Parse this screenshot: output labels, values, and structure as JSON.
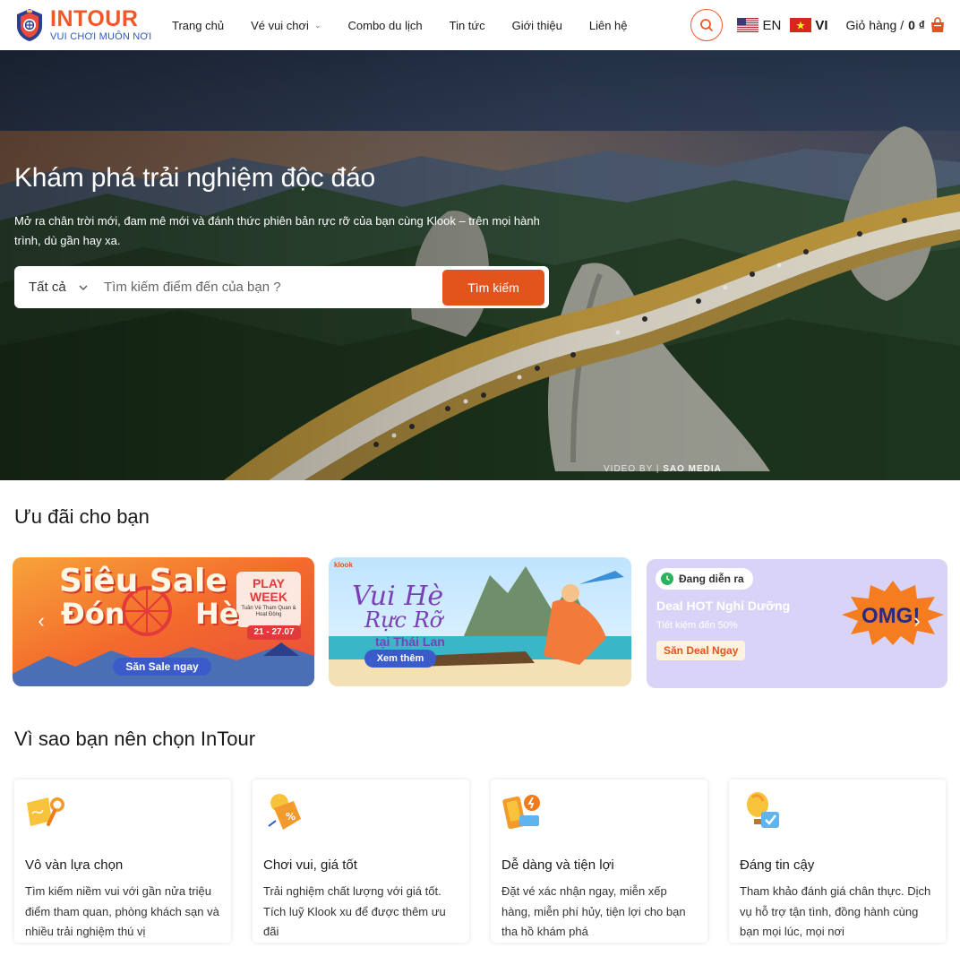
{
  "brand": {
    "name": "INTOUR",
    "tagline": "VUI CHƠI MUÔN NƠI",
    "accent": "#f0582a",
    "secondary": "#2b59c3"
  },
  "nav": {
    "items": [
      {
        "label": "Trang chủ"
      },
      {
        "label": "Vé vui chơi",
        "has_dropdown": true
      },
      {
        "label": "Combo du lịch"
      },
      {
        "label": "Tin tức"
      },
      {
        "label": "Giới thiệu"
      },
      {
        "label": "Liên hệ"
      }
    ],
    "search_icon": "search-icon",
    "lang_en": "EN",
    "lang_vi": "VI",
    "cart_label": "Giỏ hàng /",
    "cart_total": "0 ₫"
  },
  "hero": {
    "title": "Khám phá trải nghiệm độc đáo",
    "description": "Mở ra chân trời mới, đam mê mới và đánh thức phiên bản rực rỡ của bạn cùng Klook – trên mọi hành trình, dù gần hay xa.",
    "filter_label": "Tất cả",
    "search_placeholder": "Tìm kiếm điểm đến của bạn ?",
    "search_button": "Tìm kiếm",
    "button_color": "#e2541b",
    "watermark_prefix": "VIDEO BY",
    "watermark_brand": "SAO MEDIA"
  },
  "offers": {
    "title": "Ưu đãi cho bạn",
    "banner1": {
      "line1": "Siêu Sale",
      "line2": "Đón",
      "line3": "Hè",
      "badge_title": "PLAY WEEK",
      "badge_sub": "Tuần Vé Tham Quan & Hoạt Động",
      "badge_date": "21 - 27.07",
      "cta": "Săn Sale ngay"
    },
    "banner2": {
      "brand": "klook",
      "line1": "Vui Hè",
      "line2": "Rực Rỡ",
      "line3": "tại Thái Lan",
      "cta": "Xem thêm"
    },
    "banner3": {
      "status": "Đang diễn ra",
      "title": "Deal HOT Nghỉ Dưỡng",
      "subtitle": "Tiết kiệm đến 50%",
      "cta": "Săn Deal Ngay",
      "burst": "OMG!"
    }
  },
  "why": {
    "title": "Vì sao bạn nên chọn InTour",
    "cards": [
      {
        "title": "Vô vàn lựa chọn",
        "desc": "Tìm kiếm niềm vui với gần nửa triệu điểm tham quan, phòng khách sạn và nhiều trải nghiệm thú vị",
        "icon": "magnifier-map-icon"
      },
      {
        "title": "Chơi vui, giá tốt",
        "desc": "Trải nghiệm chất lượng với giá tốt. Tích luỹ Klook xu để được thêm ưu đãi",
        "icon": "discount-coin-icon"
      },
      {
        "title": "Dễ dàng và tiện lợi",
        "desc": "Đặt vé xác nhận ngay, miễn xếp hàng, miễn phí hủy, tiện lợi cho bạn tha hồ khám phá",
        "icon": "mobile-ticket-icon"
      },
      {
        "title": "Đáng tin cậy",
        "desc": "Tham khảo đánh giá chân thực. Dịch vụ hỗ trợ tận tình, đồng hành cùng bạn mọi lúc, mọi nơi",
        "icon": "balloon-check-icon"
      }
    ]
  }
}
